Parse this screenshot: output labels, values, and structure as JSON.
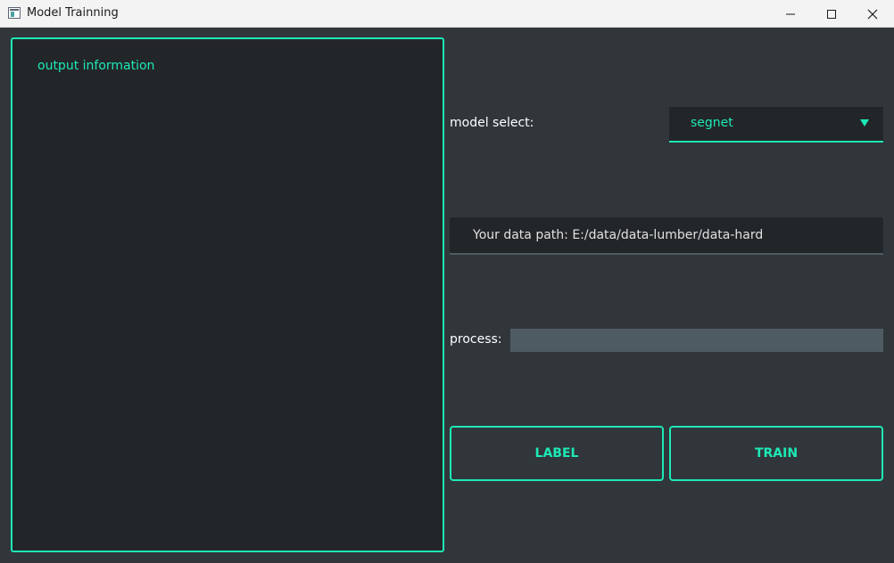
{
  "window": {
    "title": "Model Trainning"
  },
  "output": {
    "label": "output information"
  },
  "model": {
    "label": "model select:",
    "selected": "segnet"
  },
  "data_path": {
    "text": "Your data path: E:/data/data-lumber/data-hard"
  },
  "process": {
    "label": "process:",
    "progress": 0
  },
  "actions": {
    "label_button": "LABEL",
    "train_button": "TRAIN"
  },
  "colors": {
    "accent": "#1de9b6",
    "background": "#31363b",
    "panel": "#232629",
    "track": "#4f5b62"
  }
}
